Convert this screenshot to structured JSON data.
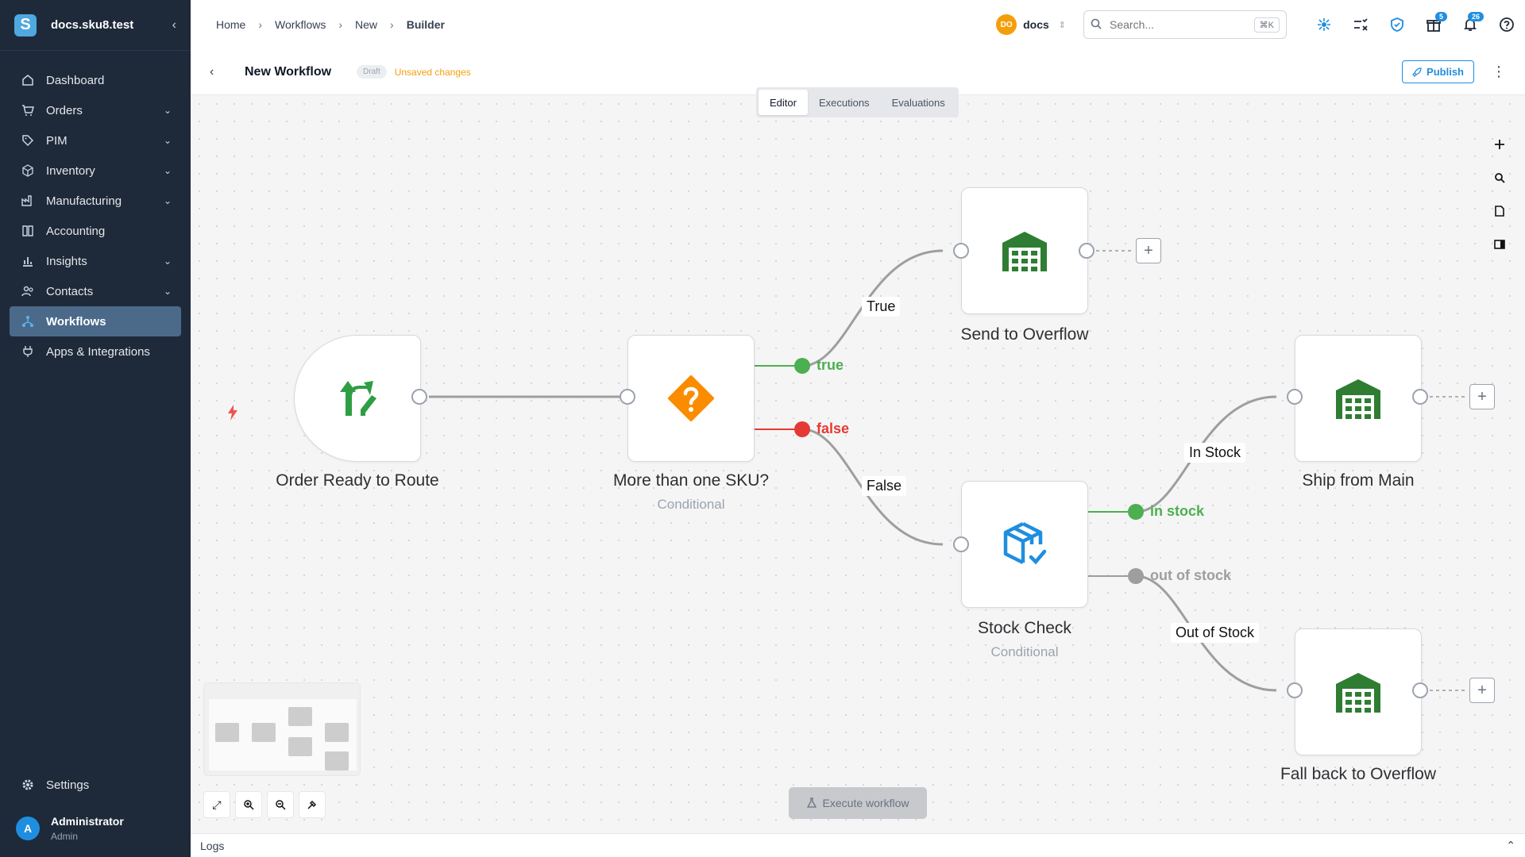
{
  "sidebar": {
    "workspace": "docs.sku8.test",
    "logo_letter": "S",
    "items": [
      {
        "label": "Dashboard",
        "icon": "home-icon",
        "has_children": false
      },
      {
        "label": "Orders",
        "icon": "cart-icon",
        "has_children": true
      },
      {
        "label": "PIM",
        "icon": "tag-icon",
        "has_children": true
      },
      {
        "label": "Inventory",
        "icon": "box-icon",
        "has_children": true
      },
      {
        "label": "Manufacturing",
        "icon": "factory-icon",
        "has_children": true
      },
      {
        "label": "Accounting",
        "icon": "book-icon",
        "has_children": false
      },
      {
        "label": "Insights",
        "icon": "chart-icon",
        "has_children": true
      },
      {
        "label": "Contacts",
        "icon": "people-icon",
        "has_children": true
      },
      {
        "label": "Workflows",
        "icon": "workflow-icon",
        "has_children": false,
        "active": true
      },
      {
        "label": "Apps & Integrations",
        "icon": "plug-icon",
        "has_children": false
      }
    ],
    "settings_label": "Settings",
    "user": {
      "initial": "A",
      "name": "Administrator",
      "role": "Admin"
    }
  },
  "topbar": {
    "breadcrumbs": [
      "Home",
      "Workflows",
      "New",
      "Builder"
    ],
    "workspace": {
      "initials": "DO",
      "name": "docs"
    },
    "search": {
      "placeholder": "Search...",
      "shortcut": "⌘K"
    },
    "gift_badge": "5",
    "notifications_badge": "26"
  },
  "subbar": {
    "title": "New Workflow",
    "status": "Draft",
    "unsaved": "Unsaved changes",
    "publish": "Publish"
  },
  "tabs": [
    "Editor",
    "Executions",
    "Evaluations"
  ],
  "active_tab": "Editor",
  "nodes": {
    "trigger": {
      "label": "Order Ready to Route"
    },
    "cond1": {
      "label": "More than one SKU?",
      "sub": "Conditional"
    },
    "overflow": {
      "label": "Send to Overflow"
    },
    "stock": {
      "label": "Stock Check",
      "sub": "Conditional"
    },
    "main": {
      "label": "Ship from Main"
    },
    "fallback": {
      "label": "Fall back to Overflow"
    }
  },
  "outputs": {
    "true": "true",
    "false": "false",
    "in_stock": "in stock",
    "out_of_stock": "out of stock"
  },
  "edge_labels": {
    "true": "True",
    "false": "False",
    "in_stock": "In Stock",
    "out_of_stock": "Out of Stock"
  },
  "colors": {
    "accent": "#1f8ee0",
    "true": "#4caf50",
    "false": "#e53935",
    "neutral": "#9e9e9e",
    "warehouse": "#2e7d32",
    "question": "#fb8c00"
  },
  "execute_label": "Execute workflow",
  "logs_label": "Logs"
}
